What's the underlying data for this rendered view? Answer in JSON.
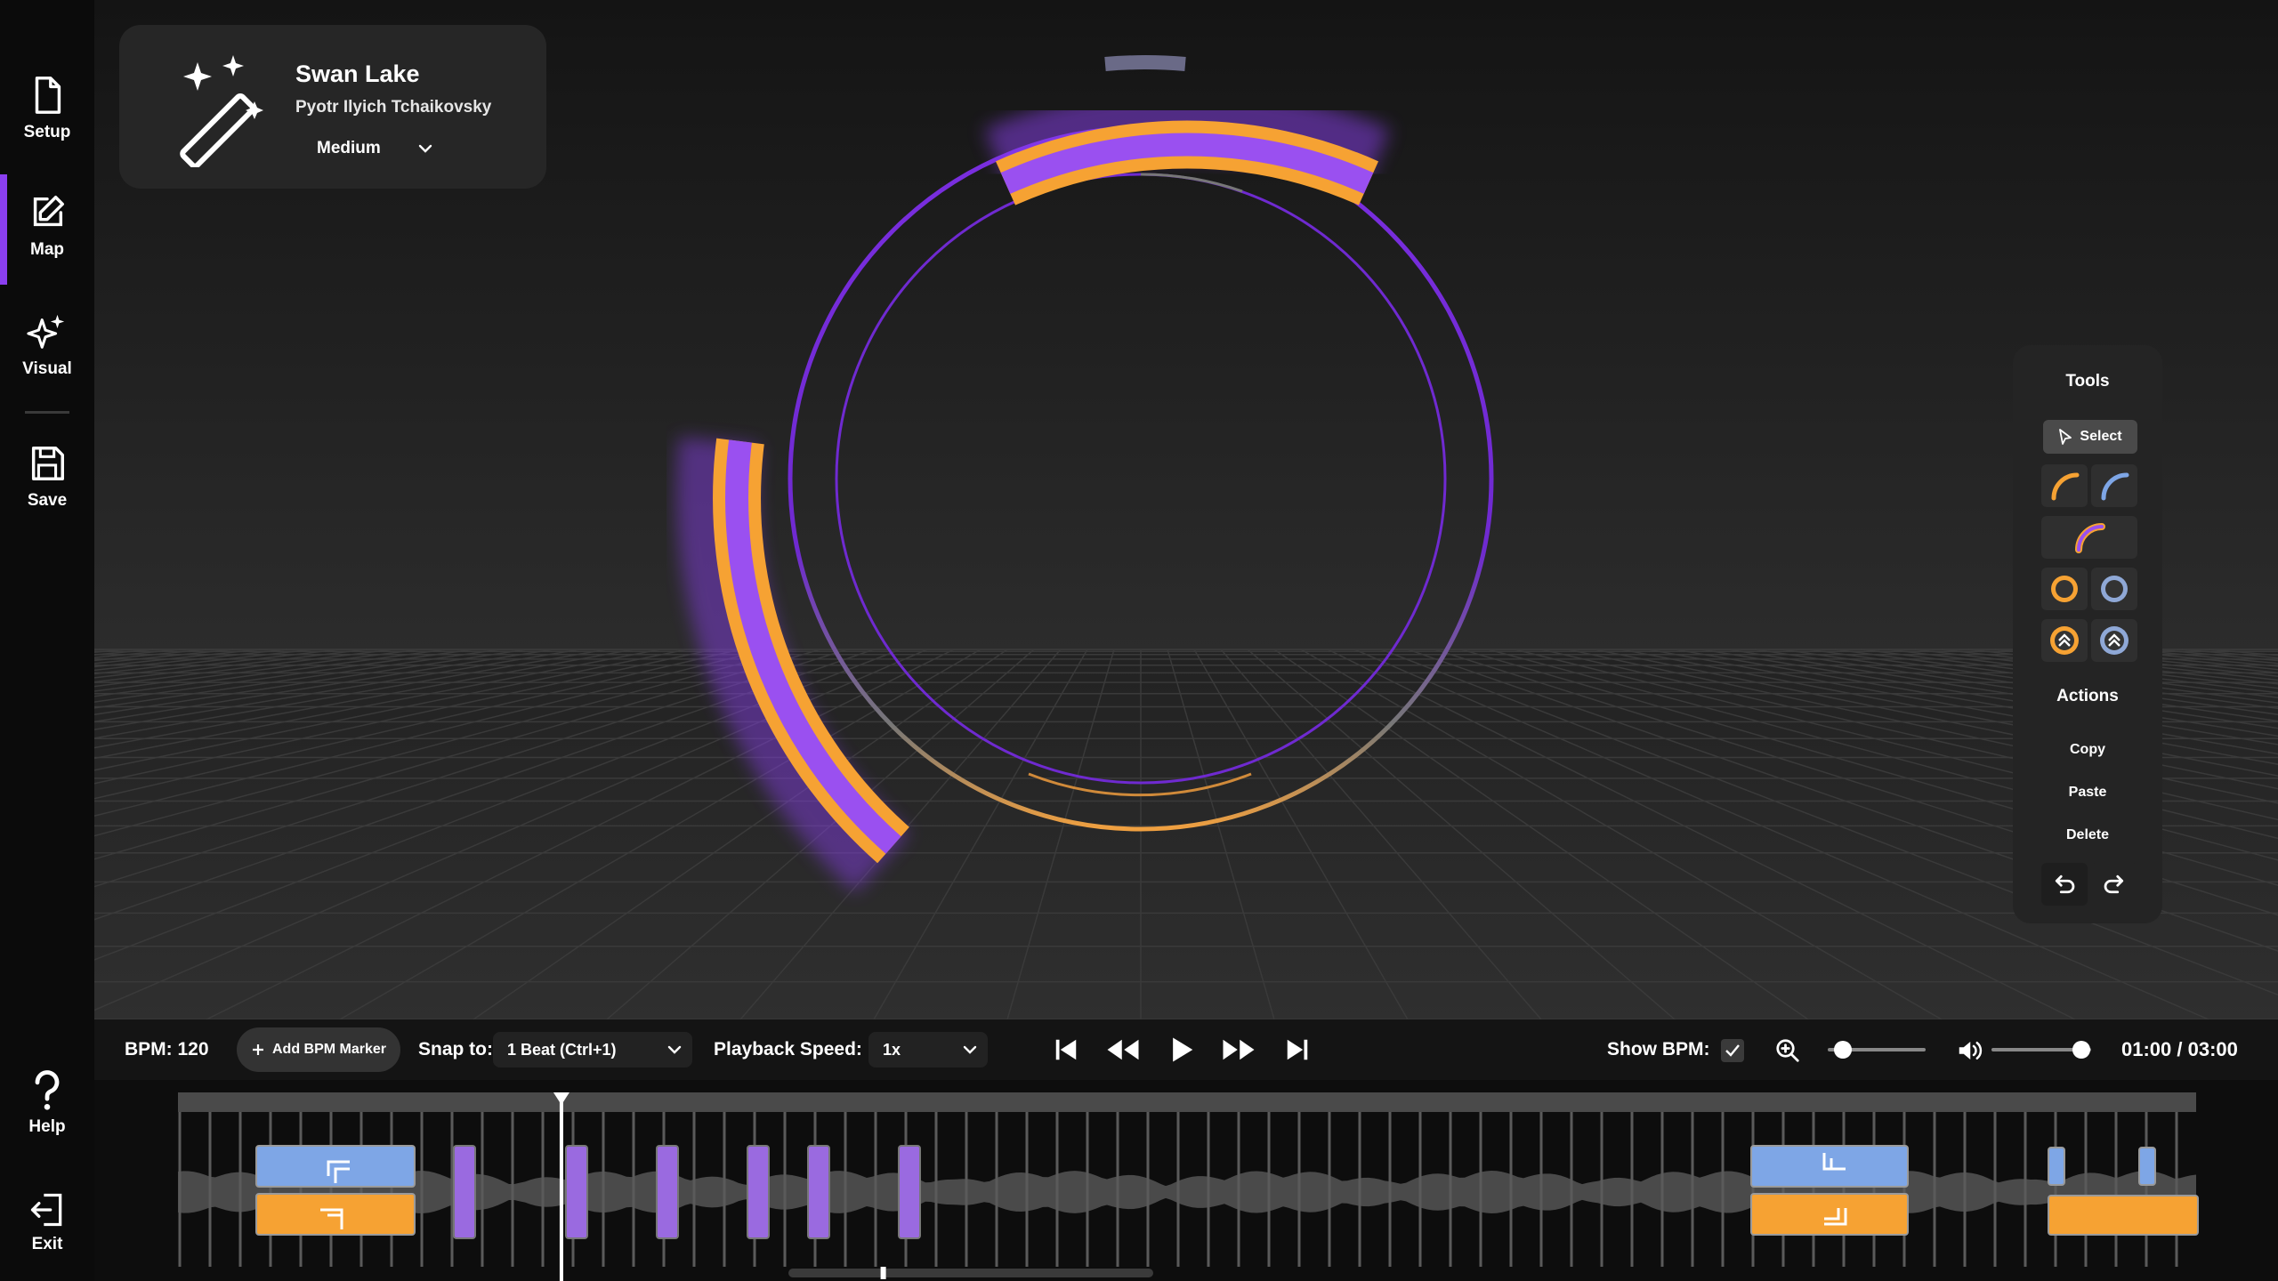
{
  "sidebar": {
    "items": [
      {
        "label": "Setup",
        "icon": "file-icon"
      },
      {
        "label": "Map",
        "icon": "edit-icon",
        "active": true
      },
      {
        "label": "Visual",
        "icon": "sparkle-icon"
      },
      {
        "label": "Save",
        "icon": "floppy-icon"
      }
    ],
    "help_label": "Help",
    "exit_label": "Exit"
  },
  "song": {
    "title": "Swan Lake",
    "artist": "Pyotr Ilyich Tchaikovsky",
    "difficulty": "Medium"
  },
  "tools": {
    "title": "Tools",
    "select_label": "Select",
    "actions_title": "Actions",
    "copy_label": "Copy",
    "paste_label": "Paste",
    "delete_label": "Delete"
  },
  "controls": {
    "bpm_label": "BPM: 120",
    "add_bpm_label": "Add BPM Marker",
    "snap_label": "Snap to:",
    "snap_value": "1 Beat (Ctrl+1)",
    "speed_label": "Playback Speed:",
    "speed_value": "1x",
    "show_bpm_label": "Show BPM:",
    "show_bpm_checked": true,
    "zoom_level": 0.15,
    "volume_level": 0.9,
    "time": "01:00 / 03:00"
  },
  "timeline": {
    "playhead_fraction": 0.19,
    "scroll_fraction": 0.26
  },
  "colors": {
    "accent_purple": "#8b3ff0",
    "accent_orange": "#f6a233",
    "accent_blue": "#7ea6e6",
    "note_purple": "#9a6ae0"
  }
}
